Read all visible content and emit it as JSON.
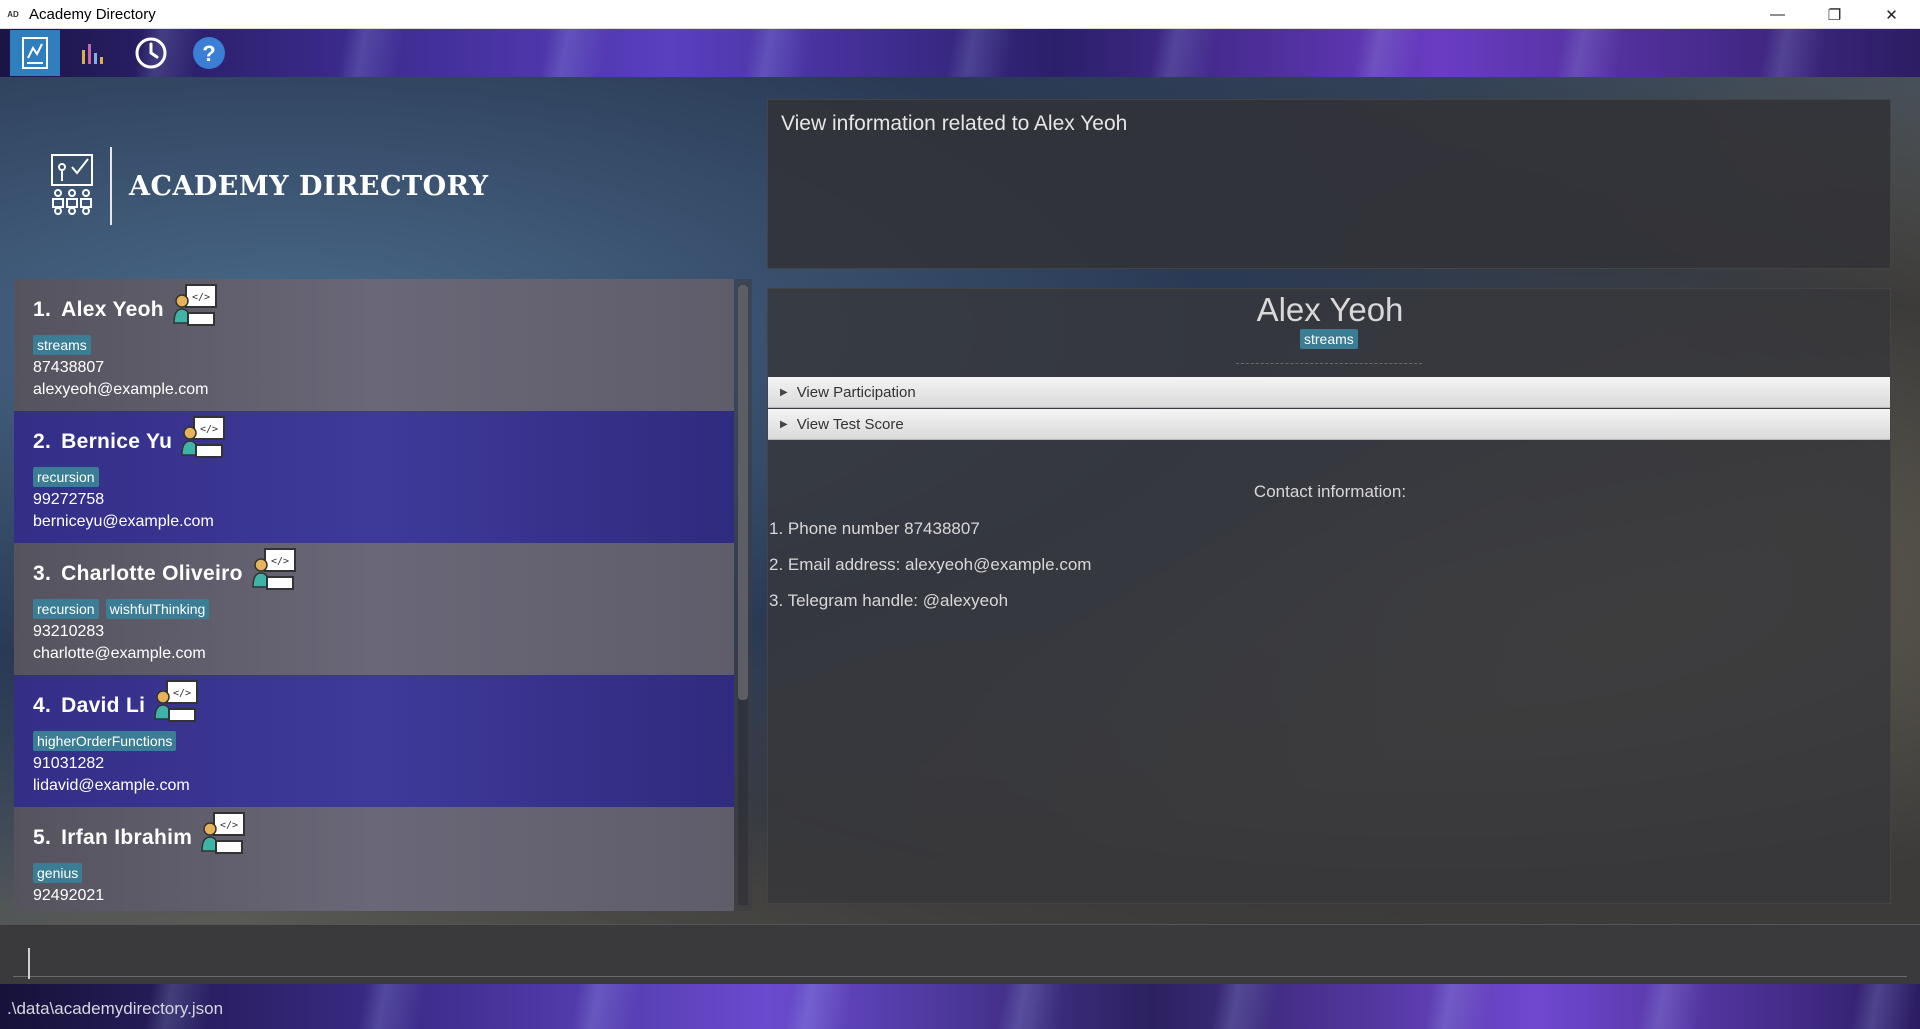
{
  "window": {
    "title": "Academy Directory",
    "app_icon_text": "AD",
    "controls": {
      "minimize": "—",
      "restore": "❐",
      "close": "✕"
    }
  },
  "toolbar": {
    "buttons": [
      {
        "name": "directory-view-icon",
        "active": true
      },
      {
        "name": "bar-chart-icon",
        "active": false
      },
      {
        "name": "history-clock-icon",
        "active": false
      },
      {
        "name": "help-icon",
        "active": false
      }
    ]
  },
  "branding": {
    "logo_text": "Academy Directory"
  },
  "students": [
    {
      "index": "1.",
      "name": "Alex Yeoh",
      "tags": [
        "streams"
      ],
      "phone": "87438807",
      "email": "alexyeoh@example.com"
    },
    {
      "index": "2.",
      "name": "Bernice Yu",
      "tags": [
        "recursion"
      ],
      "phone": "99272758",
      "email": "berniceyu@example.com"
    },
    {
      "index": "3.",
      "name": "Charlotte Oliveiro",
      "tags": [
        "recursion",
        "wishfulThinking"
      ],
      "phone": "93210283",
      "email": "charlotte@example.com"
    },
    {
      "index": "4.",
      "name": "David Li",
      "tags": [
        "higherOrderFunctions"
      ],
      "phone": "91031282",
      "email": "lidavid@example.com"
    },
    {
      "index": "5.",
      "name": "Irfan Ibrahim",
      "tags": [
        "genius"
      ],
      "phone": "92492021",
      "email": ""
    }
  ],
  "result": {
    "text": "View information related to Alex Yeoh"
  },
  "detail": {
    "name": "Alex Yeoh",
    "tag": "streams",
    "accordions": [
      "View Participation",
      "View Test Score"
    ],
    "contact_title": "Contact information:",
    "contact_lines": [
      "1. Phone number 87438807",
      "2. Email address: alexyeoh@example.com",
      "3. Telegram handle: @alexyeoh"
    ]
  },
  "command": {
    "value": "",
    "placeholder": ""
  },
  "status": {
    "path": ".\\data\\academydirectory.json"
  },
  "colors": {
    "tag_bg": "#3a7d95",
    "active_toolbar": "#2f7fbf",
    "card_even": "#3e3a9a",
    "card_odd": "#6a6878"
  }
}
